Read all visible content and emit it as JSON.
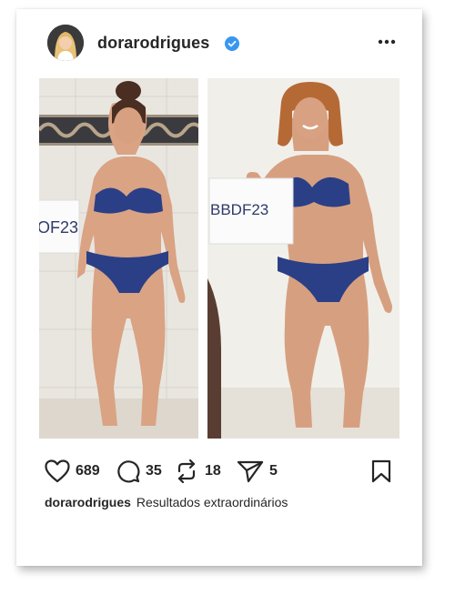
{
  "post": {
    "username": "dorarodrigues",
    "verified_icon": "verified-badge-icon",
    "more_icon": "more-dots-icon",
    "accent_color": "#3897f0"
  },
  "photo": {
    "left_sign_text": "OF23",
    "right_sign_text": "BBDF23"
  },
  "actions": {
    "likes": "689",
    "comments": "35",
    "reposts": "18",
    "shares": "5"
  },
  "caption": {
    "username": "dorarodrigues",
    "text": "Resultados extraordinários"
  }
}
